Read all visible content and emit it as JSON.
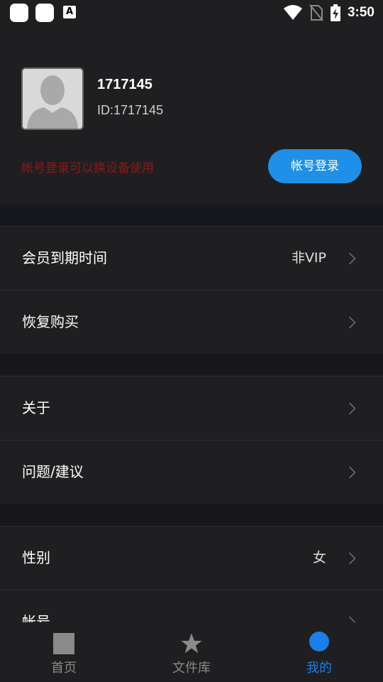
{
  "status_bar": {
    "time": "3:50",
    "app_icon_letter": "A"
  },
  "profile": {
    "username": "1717145",
    "user_id": "ID:1717145",
    "login_hint": "帐号登录可以换设备使用",
    "login_button": "帐号登录"
  },
  "menu": {
    "membership_label": "会员到期时间",
    "membership_value": "非VIP",
    "restore_label": "恢复购买",
    "about_label": "关于",
    "feedback_label": "问题/建议",
    "gender_label": "性别",
    "gender_value": "女",
    "account_label": "帐号"
  },
  "tabs": {
    "home": "首页",
    "library": "文件库",
    "mine": "我的"
  },
  "colors": {
    "accent": "#1e90e8",
    "active_tab": "#1a7fea",
    "hint": "#8b1a1a",
    "background": "#1f1f21"
  }
}
